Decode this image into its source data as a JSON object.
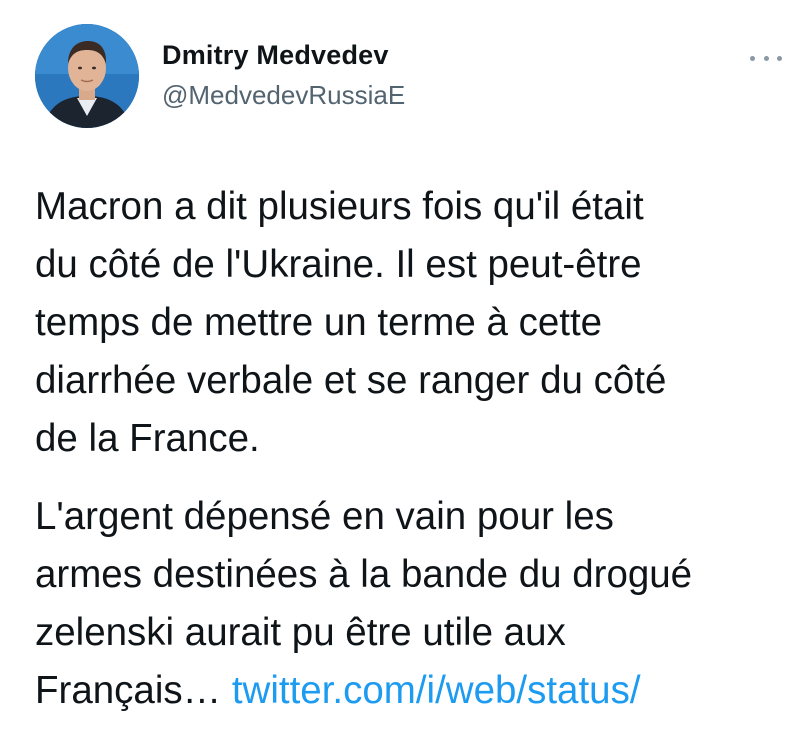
{
  "tweet": {
    "author": {
      "display_name": "Dmitry Medvedev",
      "handle": "@MedvedevRussiaE"
    },
    "more_icon": "more-horizontal-icon",
    "paragraph1": {
      "lines": [
        "Macron a dit plusieurs fois qu'il était",
        "du côté de l'Ukraine. Il est peut-être",
        "temps de mettre un terme à cette",
        "diarrhée verbale et se ranger du côté",
        "de la France."
      ]
    },
    "paragraph2": {
      "lines": [
        "L'argent dépensé en vain pour les",
        "armes destinées à la bande du drogué",
        "zelenski aurait pu être utile aux"
      ],
      "last_line_text": "Français…",
      "link_text": "twitter.com/i/web/status/"
    }
  },
  "colors": {
    "text": "#0f1419",
    "secondary": "#536471",
    "link": "#1d9bf0",
    "background": "#ffffff"
  }
}
